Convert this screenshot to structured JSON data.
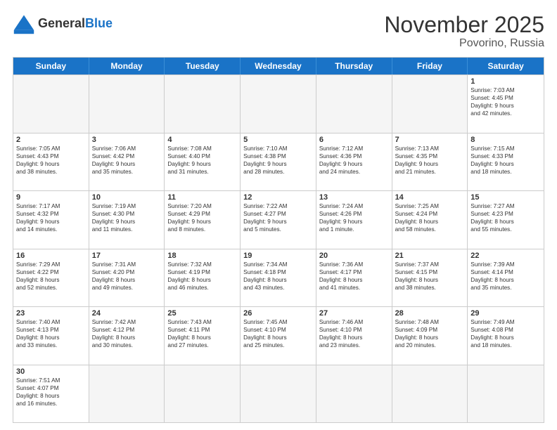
{
  "header": {
    "logo_general": "General",
    "logo_blue": "Blue",
    "title": "November 2025",
    "subtitle": "Povorinо, Russia"
  },
  "weekdays": [
    "Sunday",
    "Monday",
    "Tuesday",
    "Wednesday",
    "Thursday",
    "Friday",
    "Saturday"
  ],
  "rows": [
    [
      {
        "day": "",
        "info": ""
      },
      {
        "day": "",
        "info": ""
      },
      {
        "day": "",
        "info": ""
      },
      {
        "day": "",
        "info": ""
      },
      {
        "day": "",
        "info": ""
      },
      {
        "day": "",
        "info": ""
      },
      {
        "day": "1",
        "info": "Sunrise: 7:03 AM\nSunset: 4:45 PM\nDaylight: 9 hours\nand 42 minutes."
      }
    ],
    [
      {
        "day": "2",
        "info": "Sunrise: 7:05 AM\nSunset: 4:43 PM\nDaylight: 9 hours\nand 38 minutes."
      },
      {
        "day": "3",
        "info": "Sunrise: 7:06 AM\nSunset: 4:42 PM\nDaylight: 9 hours\nand 35 minutes."
      },
      {
        "day": "4",
        "info": "Sunrise: 7:08 AM\nSunset: 4:40 PM\nDaylight: 9 hours\nand 31 minutes."
      },
      {
        "day": "5",
        "info": "Sunrise: 7:10 AM\nSunset: 4:38 PM\nDaylight: 9 hours\nand 28 minutes."
      },
      {
        "day": "6",
        "info": "Sunrise: 7:12 AM\nSunset: 4:36 PM\nDaylight: 9 hours\nand 24 minutes."
      },
      {
        "day": "7",
        "info": "Sunrise: 7:13 AM\nSunset: 4:35 PM\nDaylight: 9 hours\nand 21 minutes."
      },
      {
        "day": "8",
        "info": "Sunrise: 7:15 AM\nSunset: 4:33 PM\nDaylight: 9 hours\nand 18 minutes."
      }
    ],
    [
      {
        "day": "9",
        "info": "Sunrise: 7:17 AM\nSunset: 4:32 PM\nDaylight: 9 hours\nand 14 minutes."
      },
      {
        "day": "10",
        "info": "Sunrise: 7:19 AM\nSunset: 4:30 PM\nDaylight: 9 hours\nand 11 minutes."
      },
      {
        "day": "11",
        "info": "Sunrise: 7:20 AM\nSunset: 4:29 PM\nDaylight: 9 hours\nand 8 minutes."
      },
      {
        "day": "12",
        "info": "Sunrise: 7:22 AM\nSunset: 4:27 PM\nDaylight: 9 hours\nand 5 minutes."
      },
      {
        "day": "13",
        "info": "Sunrise: 7:24 AM\nSunset: 4:26 PM\nDaylight: 9 hours\nand 1 minute."
      },
      {
        "day": "14",
        "info": "Sunrise: 7:25 AM\nSunset: 4:24 PM\nDaylight: 8 hours\nand 58 minutes."
      },
      {
        "day": "15",
        "info": "Sunrise: 7:27 AM\nSunset: 4:23 PM\nDaylight: 8 hours\nand 55 minutes."
      }
    ],
    [
      {
        "day": "16",
        "info": "Sunrise: 7:29 AM\nSunset: 4:22 PM\nDaylight: 8 hours\nand 52 minutes."
      },
      {
        "day": "17",
        "info": "Sunrise: 7:31 AM\nSunset: 4:20 PM\nDaylight: 8 hours\nand 49 minutes."
      },
      {
        "day": "18",
        "info": "Sunrise: 7:32 AM\nSunset: 4:19 PM\nDaylight: 8 hours\nand 46 minutes."
      },
      {
        "day": "19",
        "info": "Sunrise: 7:34 AM\nSunset: 4:18 PM\nDaylight: 8 hours\nand 43 minutes."
      },
      {
        "day": "20",
        "info": "Sunrise: 7:36 AM\nSunset: 4:17 PM\nDaylight: 8 hours\nand 41 minutes."
      },
      {
        "day": "21",
        "info": "Sunrise: 7:37 AM\nSunset: 4:15 PM\nDaylight: 8 hours\nand 38 minutes."
      },
      {
        "day": "22",
        "info": "Sunrise: 7:39 AM\nSunset: 4:14 PM\nDaylight: 8 hours\nand 35 minutes."
      }
    ],
    [
      {
        "day": "23",
        "info": "Sunrise: 7:40 AM\nSunset: 4:13 PM\nDaylight: 8 hours\nand 33 minutes."
      },
      {
        "day": "24",
        "info": "Sunrise: 7:42 AM\nSunset: 4:12 PM\nDaylight: 8 hours\nand 30 minutes."
      },
      {
        "day": "25",
        "info": "Sunrise: 7:43 AM\nSunset: 4:11 PM\nDaylight: 8 hours\nand 27 minutes."
      },
      {
        "day": "26",
        "info": "Sunrise: 7:45 AM\nSunset: 4:10 PM\nDaylight: 8 hours\nand 25 minutes."
      },
      {
        "day": "27",
        "info": "Sunrise: 7:46 AM\nSunset: 4:10 PM\nDaylight: 8 hours\nand 23 minutes."
      },
      {
        "day": "28",
        "info": "Sunrise: 7:48 AM\nSunset: 4:09 PM\nDaylight: 8 hours\nand 20 minutes."
      },
      {
        "day": "29",
        "info": "Sunrise: 7:49 AM\nSunset: 4:08 PM\nDaylight: 8 hours\nand 18 minutes."
      }
    ],
    [
      {
        "day": "30",
        "info": "Sunrise: 7:51 AM\nSunset: 4:07 PM\nDaylight: 8 hours\nand 16 minutes."
      },
      {
        "day": "",
        "info": ""
      },
      {
        "day": "",
        "info": ""
      },
      {
        "day": "",
        "info": ""
      },
      {
        "day": "",
        "info": ""
      },
      {
        "day": "",
        "info": ""
      },
      {
        "day": "",
        "info": ""
      }
    ]
  ]
}
